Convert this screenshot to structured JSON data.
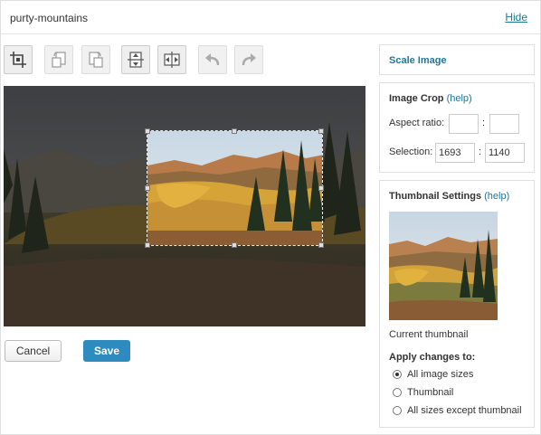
{
  "header": {
    "title": "purty-mountains",
    "hide_label": "Hide"
  },
  "buttons": {
    "cancel": "Cancel",
    "save": "Save"
  },
  "scale_panel": {
    "title": "Scale Image"
  },
  "crop_panel": {
    "title": "Image Crop",
    "help": "(help)",
    "aspect_label": "Aspect ratio:",
    "aspect_w": "",
    "aspect_h": "",
    "selection_label": "Selection:",
    "selection_w": "1693",
    "selection_h": "1140",
    "separator": ":"
  },
  "thumb_panel": {
    "title": "Thumbnail Settings",
    "help": "(help)",
    "current": "Current thumbnail",
    "apply_label": "Apply changes to:",
    "options": [
      "All image sizes",
      "Thumbnail",
      "All sizes except thumbnail"
    ],
    "selected_option": 0
  },
  "toolbar": {
    "icons": [
      "crop-icon",
      "rotate-left-icon",
      "rotate-right-icon",
      "flip-vertical-icon",
      "flip-horizontal-icon",
      "undo-icon",
      "redo-icon"
    ]
  }
}
